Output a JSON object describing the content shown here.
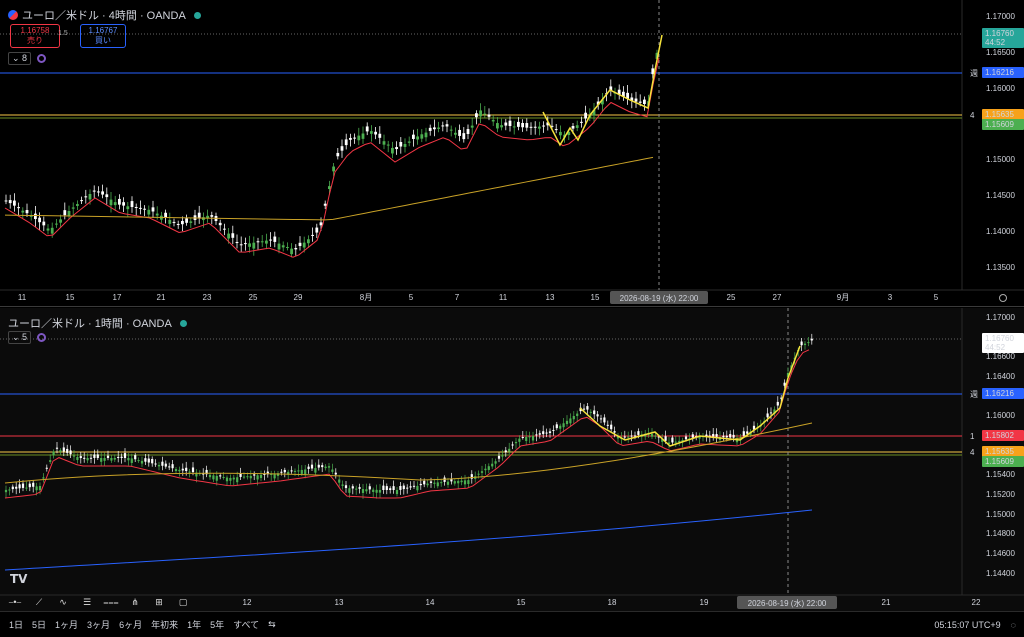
{
  "pane1": {
    "title": "ユーロ／米ドル · 4時間 · OANDA",
    "sell_price": "1.16758",
    "sell_label": "売り",
    "buy_price": "1.16767",
    "buy_label": "買い",
    "spread": "1.5",
    "indicator_count": "8",
    "price_ticks": [
      "1.17000",
      "1.16500",
      "1.16000",
      "1.15500",
      "1.15000",
      "1.14500",
      "1.14000",
      "1.13500"
    ],
    "date_ticks": [
      "11",
      "15",
      "17",
      "21",
      "23",
      "25",
      "29",
      "8月",
      "5",
      "7",
      "11",
      "13",
      "15",
      "25",
      "27",
      "9月",
      "3",
      "5"
    ],
    "crosshair_date": "2026-08-19 (水)  22:00",
    "labels": [
      {
        "value": "1.16760",
        "sub": "44:52",
        "color": "#26a69a"
      },
      {
        "value": "1.16216",
        "tag": "週",
        "color": "#2962ff"
      },
      {
        "value": "1.15635",
        "tag": "4",
        "color": "#f7a21b"
      },
      {
        "value": "1.15609",
        "color": "#4caf50"
      }
    ]
  },
  "pane2": {
    "title": "ユーロ／米ドル · 1時間 · OANDA",
    "indicator_count": "5",
    "price_ticks": [
      "1.17000",
      "1.16600",
      "1.16400",
      "1.16000",
      "1.15400",
      "1.15200",
      "1.15000",
      "1.14800",
      "1.14600",
      "1.14400"
    ],
    "date_ticks": [
      "12",
      "13",
      "14",
      "15",
      "18",
      "19",
      "21",
      "22"
    ],
    "crosshair_date": "2026-08-19 (水)  22:00",
    "labels": [
      {
        "value": "1.16760",
        "sub": "44:52",
        "color": "#ffffff"
      },
      {
        "value": "1.16216",
        "tag": "週",
        "color": "#2962ff"
      },
      {
        "value": "1.15802",
        "tag": "1",
        "color": "#f23645"
      },
      {
        "value": "1.15635",
        "tag": "4",
        "color": "#f7a21b"
      },
      {
        "value": "1.15609",
        "color": "#4caf50"
      }
    ]
  },
  "bottombar": {
    "ranges": [
      "1日",
      "5日",
      "1ヶ月",
      "3ヶ月",
      "6ヶ月",
      "年初来",
      "1年",
      "5年",
      "すべて"
    ],
    "time": "05:15:07 UTC+9"
  },
  "colors": {
    "up": "#4caf50",
    "down": "#ffffff",
    "ema_short": "#f23645",
    "ema_long": "#f7c948",
    "sma_blue": "#2962ff",
    "zigzag": "#f5e23b"
  }
}
